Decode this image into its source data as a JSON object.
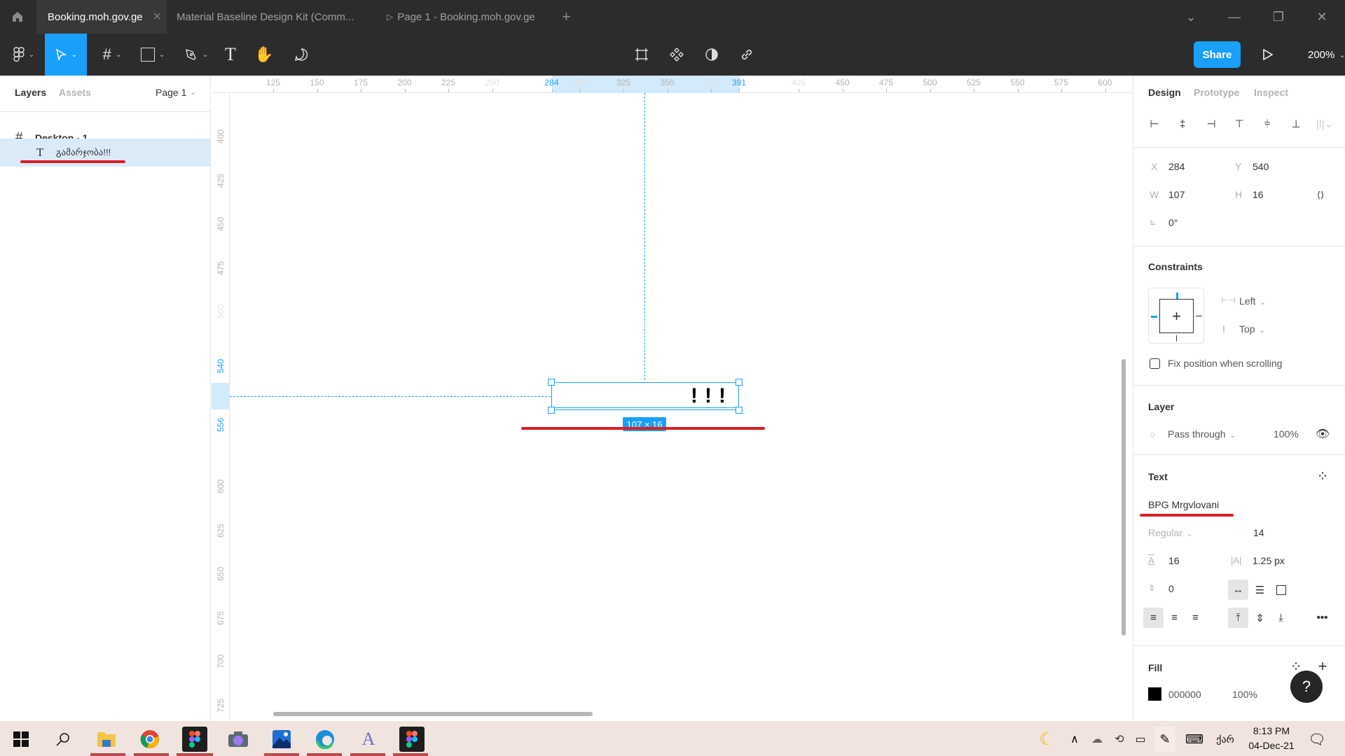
{
  "browser": {
    "tabs": [
      {
        "label": "Booking.moh.gov.ge",
        "active": true
      },
      {
        "label": "Material Baseline Design Kit (Comm...",
        "active": false
      },
      {
        "label": "Page 1 - Booking.moh.gov.ge",
        "active": false,
        "icon": "play-icon"
      }
    ],
    "new_tab": "+",
    "window_controls": {
      "dropdown": "⌄",
      "minimize": "—",
      "maximize": "❐",
      "close": "✕"
    }
  },
  "toolbar": {
    "tools": [
      "figma-menu",
      "move",
      "frame",
      "shape",
      "pen",
      "text",
      "hand",
      "comment"
    ],
    "center_tools": [
      "crop",
      "component",
      "mask",
      "link"
    ],
    "share_label": "Share",
    "zoom": "200%",
    "zoom_caret": "⌄"
  },
  "left_panel": {
    "tabs": {
      "layers": "Layers",
      "assets": "Assets"
    },
    "page": "Page 1",
    "layers": [
      {
        "name": "Desktop - 1",
        "type": "frame"
      },
      {
        "name": "გამარჯობა!!!",
        "type": "text",
        "selected": true
      }
    ]
  },
  "rulers": {
    "horizontal": [
      {
        "v": "125"
      },
      {
        "v": "150"
      },
      {
        "v": "175"
      },
      {
        "v": "200"
      },
      {
        "v": "225"
      },
      {
        "v": "250",
        "faint": true
      },
      {
        "v": "284",
        "hl": true
      },
      {
        "v": "300",
        "faint": true
      },
      {
        "v": "325"
      },
      {
        "v": "350"
      },
      {
        "v": "375",
        "faint": true
      },
      {
        "v": "391",
        "hl": true
      },
      {
        "v": "425",
        "faint": true
      },
      {
        "v": "450"
      },
      {
        "v": "475"
      },
      {
        "v": "500"
      },
      {
        "v": "525"
      },
      {
        "v": "550"
      },
      {
        "v": "575"
      },
      {
        "v": "600"
      }
    ],
    "vertical": [
      {
        "v": "400"
      },
      {
        "v": "425"
      },
      {
        "v": "450"
      },
      {
        "v": "475"
      },
      {
        "v": "500",
        "faint": true
      },
      {
        "v": "540",
        "hl": true
      },
      {
        "v": "556",
        "hl": true
      },
      {
        "v": "600"
      },
      {
        "v": "625"
      },
      {
        "v": "650"
      },
      {
        "v": "675"
      },
      {
        "v": "700"
      },
      {
        "v": "725"
      }
    ]
  },
  "canvas": {
    "selected_text_visible": "!!!",
    "size_badge": "107 × 16"
  },
  "right_panel": {
    "tabs": {
      "design": "Design",
      "prototype": "Prototype",
      "inspect": "Inspect"
    },
    "position": {
      "x_label": "X",
      "x": "284",
      "y_label": "Y",
      "y": "540",
      "w_label": "W",
      "w": "107",
      "h_label": "H",
      "h": "16",
      "rotation": "0°"
    },
    "constraints": {
      "title": "Constraints",
      "horizontal": "Left",
      "vertical": "Top",
      "fix_position_label": "Fix position when scrolling",
      "fix_position_checked": false
    },
    "layer": {
      "title": "Layer",
      "blend": "Pass through",
      "opacity": "100%"
    },
    "text": {
      "title": "Text",
      "font_family": "BPG Mrgvlovani",
      "font_weight": "Regular",
      "font_size": "14",
      "line_height": "16",
      "letter_spacing": "1.25 px",
      "paragraph_spacing": "0"
    },
    "fill": {
      "title": "Fill",
      "color_hex": "000000",
      "opacity": "100%",
      "swatch": "#000000"
    },
    "help": "?"
  },
  "taskbar": {
    "apps": [
      "windows-start",
      "search",
      "file-explorer",
      "chrome",
      "figma",
      "camera",
      "photos",
      "edge",
      "font-viewer",
      "figma"
    ],
    "tray": {
      "lang": "ქარ",
      "time": "8:13 PM",
      "date": "04-Dec-21"
    }
  },
  "colors": {
    "accent": "#18a0fb",
    "annotation_red": "#d91f26",
    "selection_bg": "#daebf7"
  }
}
